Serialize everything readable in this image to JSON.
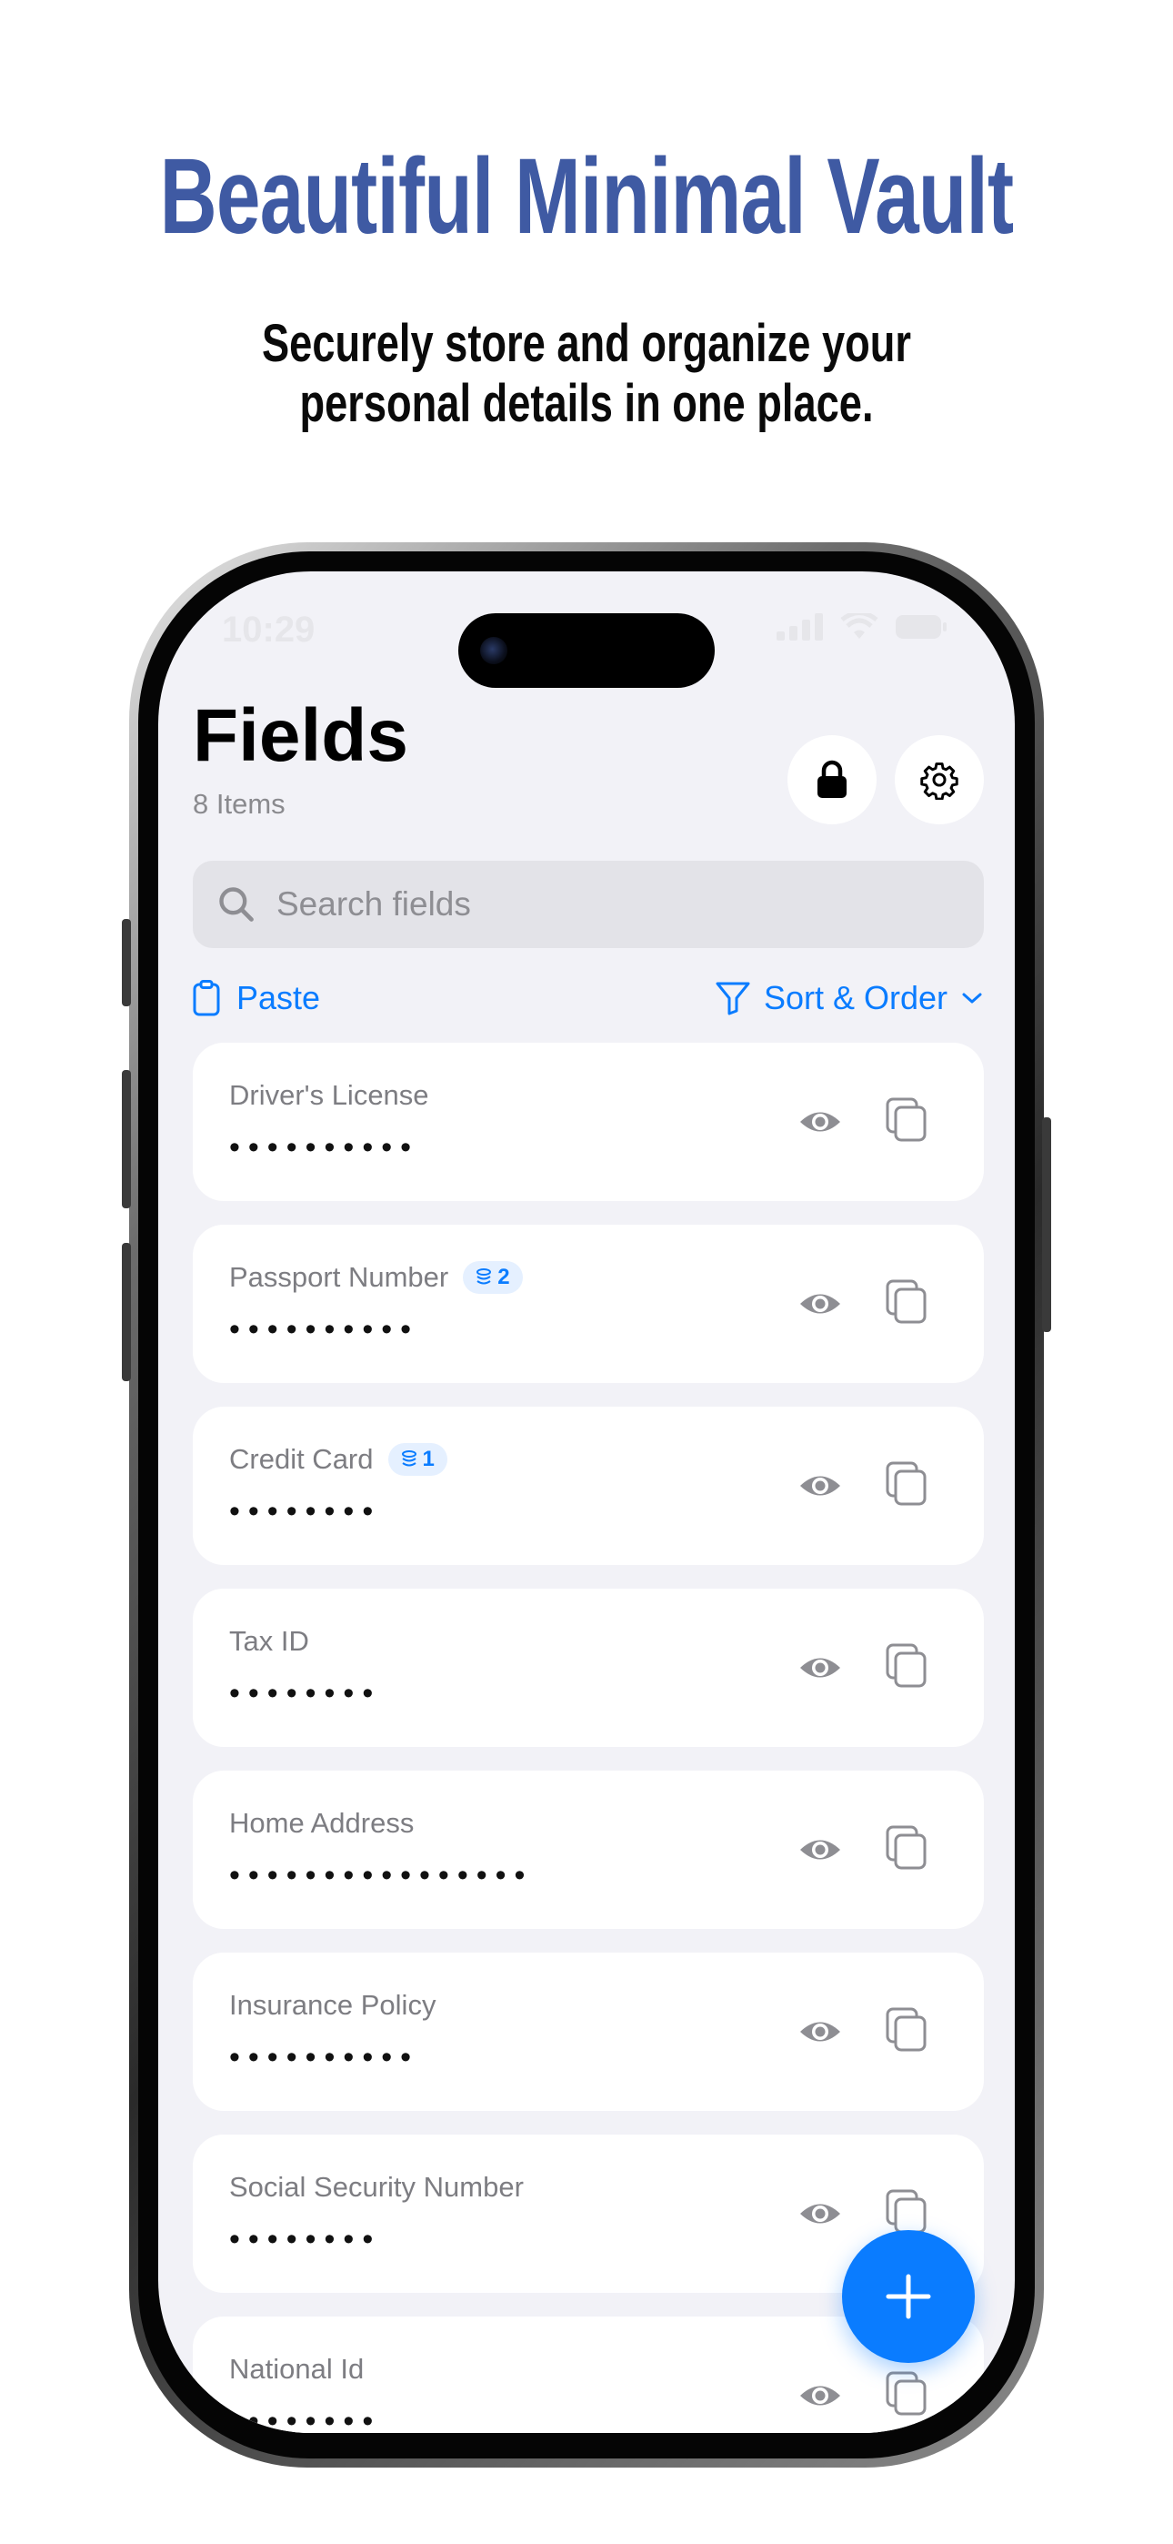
{
  "promo": {
    "headline": "Beautiful Minimal Vault",
    "subline_1": "Securely store and organize your",
    "subline_2": "personal details in one place."
  },
  "status_bar": {
    "time": "10:29"
  },
  "header": {
    "title": "Fields",
    "count": "8 Items"
  },
  "search": {
    "placeholder": "Search fields"
  },
  "toolbar": {
    "paste_label": "Paste",
    "sort_label": "Sort & Order"
  },
  "fields": [
    {
      "label": "Driver's License",
      "value": "••••••••••",
      "badge": ""
    },
    {
      "label": "Passport Number",
      "value": "••••••••••",
      "badge": "2"
    },
    {
      "label": "Credit Card",
      "value": "••••••••",
      "badge": "1"
    },
    {
      "label": "Tax ID",
      "value": "••••••••",
      "badge": ""
    },
    {
      "label": "Home Address",
      "value": "••••••••••••••••",
      "badge": ""
    },
    {
      "label": "Insurance Policy",
      "value": "••••••••••",
      "badge": ""
    },
    {
      "label": "Social Security Number",
      "value": "••••••••",
      "badge": ""
    },
    {
      "label": "National Id",
      "value": "••••••••",
      "badge": ""
    }
  ],
  "colors": {
    "accent": "#0a7cff",
    "headline": "#3f5aa3",
    "background": "#f2f2f7"
  },
  "icons": [
    "lock-icon",
    "gear-icon",
    "search-icon",
    "clipboard-icon",
    "filter-icon",
    "chevron-down-icon",
    "eye-icon",
    "copy-icon",
    "stack-icon",
    "plus-icon"
  ]
}
